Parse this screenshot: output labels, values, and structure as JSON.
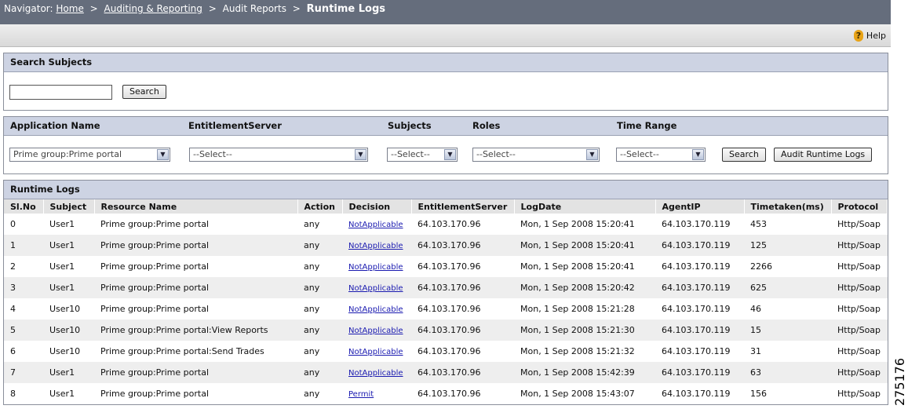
{
  "navigator": {
    "prefix": "Navigator:",
    "home": "Home",
    "auditing": "Auditing & Reporting",
    "audit_reports": "Audit Reports",
    "current": "Runtime Logs",
    "sep": ">"
  },
  "help": {
    "icon": "help-icon",
    "glyph": "?",
    "label": "Help"
  },
  "search_subjects": {
    "title": "Search Subjects",
    "input_value": "",
    "button": "Search"
  },
  "filters": {
    "labels": {
      "application": "Application Name",
      "entitlement": "EntitlementServer",
      "subjects": "Subjects",
      "roles": "Roles",
      "time_range": "Time Range"
    },
    "application_value": "Prime group:Prime portal",
    "entitlement_value": "--Select--",
    "subjects_value": "--Select--",
    "roles_value": "--Select--",
    "time_range_value": "--Select--",
    "search_button": "Search",
    "audit_button": "Audit Runtime Logs"
  },
  "runtime_logs": {
    "title": "Runtime Logs",
    "columns": [
      "Sl.No",
      "Subject",
      "Resource Name",
      "Action",
      "Decision",
      "EntitlementServer",
      "LogDate",
      "AgentIP",
      "Timetaken(ms)",
      "Protocol"
    ],
    "rows": [
      [
        "0",
        "User1",
        "Prime group:Prime portal",
        "any",
        "NotApplicable",
        "64.103.170.96",
        "Mon, 1 Sep 2008 15:20:41",
        "64.103.170.119",
        "453",
        "Http/Soap"
      ],
      [
        "1",
        "User1",
        "Prime group:Prime portal",
        "any",
        "NotApplicable",
        "64.103.170.96",
        "Mon, 1 Sep 2008 15:20:41",
        "64.103.170.119",
        "125",
        "Http/Soap"
      ],
      [
        "2",
        "User1",
        "Prime group:Prime portal",
        "any",
        "NotApplicable",
        "64.103.170.96",
        "Mon, 1 Sep 2008 15:20:41",
        "64.103.170.119",
        "2266",
        "Http/Soap"
      ],
      [
        "3",
        "User1",
        "Prime group:Prime portal",
        "any",
        "NotApplicable",
        "64.103.170.96",
        "Mon, 1 Sep 2008 15:20:42",
        "64.103.170.119",
        "625",
        "Http/Soap"
      ],
      [
        "4",
        "User10",
        "Prime group:Prime portal",
        "any",
        "NotApplicable",
        "64.103.170.96",
        "Mon, 1 Sep 2008 15:21:28",
        "64.103.170.119",
        "46",
        "Http/Soap"
      ],
      [
        "5",
        "User10",
        "Prime group:Prime portal:View Reports",
        "any",
        "NotApplicable",
        "64.103.170.96",
        "Mon, 1 Sep 2008 15:21:30",
        "64.103.170.119",
        "15",
        "Http/Soap"
      ],
      [
        "6",
        "User10",
        "Prime group:Prime portal:Send Trades",
        "any",
        "NotApplicable",
        "64.103.170.96",
        "Mon, 1 Sep 2008 15:21:32",
        "64.103.170.119",
        "31",
        "Http/Soap"
      ],
      [
        "7",
        "User1",
        "Prime group:Prime portal",
        "any",
        "NotApplicable",
        "64.103.170.96",
        "Mon, 1 Sep 2008 15:42:39",
        "64.103.170.119",
        "63",
        "Http/Soap"
      ],
      [
        "8",
        "User1",
        "Prime group:Prime portal",
        "any",
        "Permit",
        "64.103.170.96",
        "Mon, 1 Sep 2008 15:43:07",
        "64.103.170.119",
        "156",
        "Http/Soap"
      ]
    ]
  },
  "figure_id": "275176"
}
